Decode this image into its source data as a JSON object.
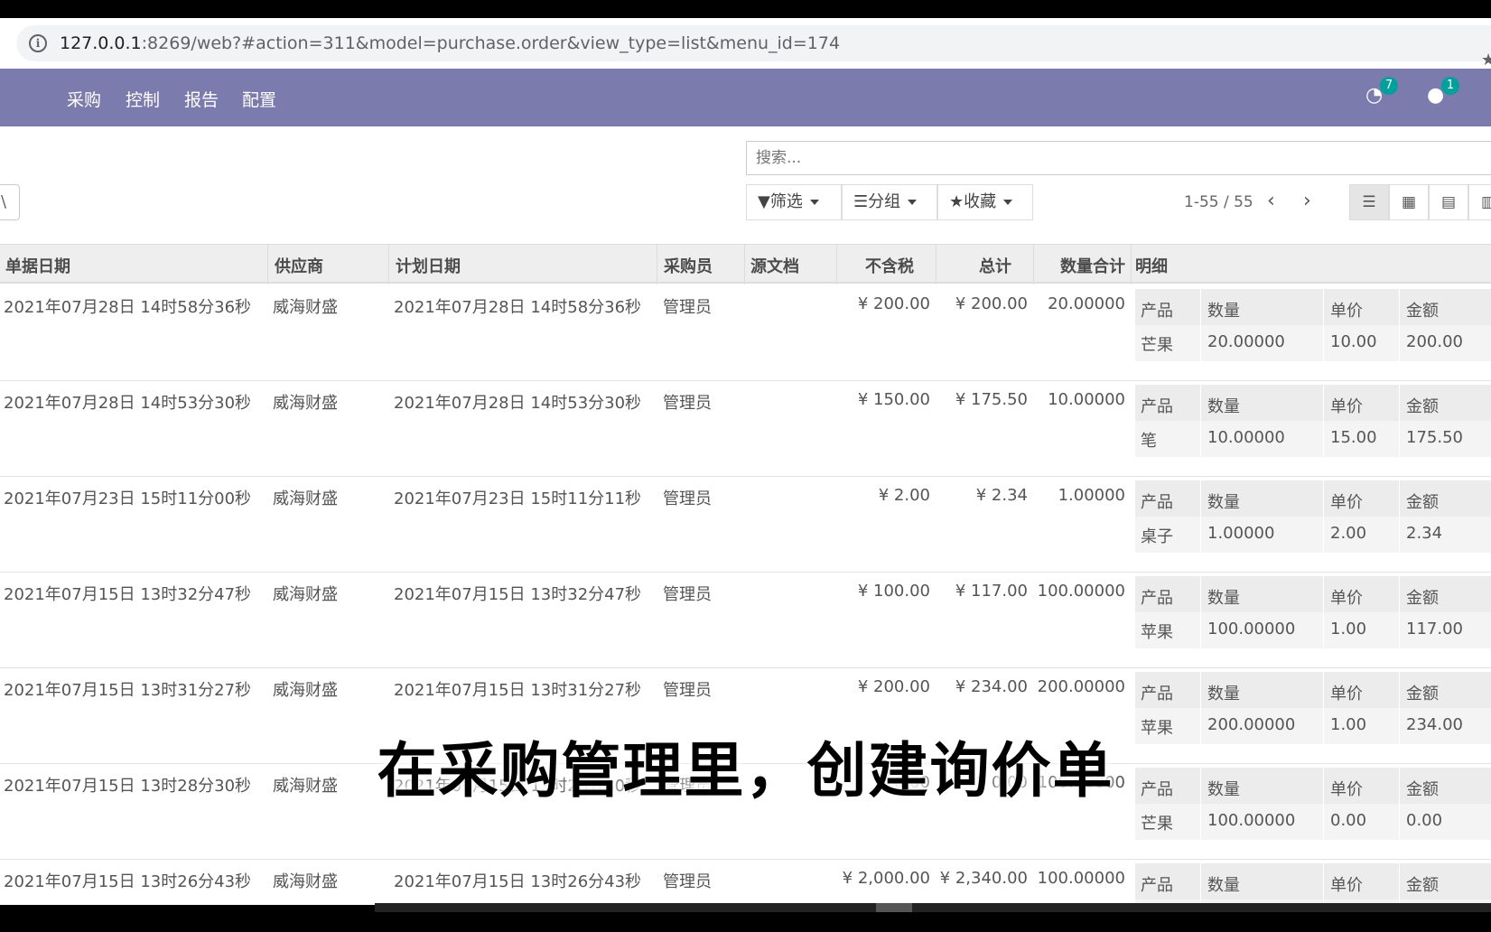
{
  "browser": {
    "url_host": "127.0.0.1",
    "url_path": ":8269/web?#action=311&model=purchase.order&view_type=list&menu_id=174"
  },
  "navbar": {
    "items": [
      "采购",
      "控制",
      "报告",
      "配置"
    ],
    "activity_count": "7",
    "message_count": "1"
  },
  "control_panel": {
    "search_placeholder": "搜索...",
    "create_stub": "\\",
    "filter_label": "筛选",
    "group_label": "分组",
    "favorites_label": "收藏",
    "pager": "1-55 / 55"
  },
  "table": {
    "headers": {
      "date": "单据日期",
      "vendor": "供应商",
      "planned": "计划日期",
      "buyer": "采购员",
      "source": "源文档",
      "untaxed": "不含税",
      "total": "总计",
      "qty": "数量合计",
      "detail": "明细"
    },
    "detail_headers": [
      "产品",
      "数量",
      "单价",
      "金额"
    ],
    "rows": [
      {
        "date": "2021年07月28日 14时58分36秒",
        "vendor": "威海财盛",
        "planned": "2021年07月28日 14时58分36秒",
        "buyer": "管理员",
        "source": "",
        "untaxed": "¥ 200.00",
        "total": "¥ 200.00",
        "qty": "20.00000",
        "line": {
          "product": "芒果",
          "qty": "20.00000",
          "price": "10.00",
          "amount": "200.00"
        }
      },
      {
        "date": "2021年07月28日 14时53分30秒",
        "vendor": "威海财盛",
        "planned": "2021年07月28日 14时53分30秒",
        "buyer": "管理员",
        "source": "",
        "untaxed": "¥ 150.00",
        "total": "¥ 175.50",
        "qty": "10.00000",
        "line": {
          "product": "笔",
          "qty": "10.00000",
          "price": "15.00",
          "amount": "175.50"
        }
      },
      {
        "date": "2021年07月23日 15时11分00秒",
        "vendor": "威海财盛",
        "planned": "2021年07月23日 15时11分11秒",
        "buyer": "管理员",
        "source": "",
        "untaxed": "¥ 2.00",
        "total": "¥ 2.34",
        "qty": "1.00000",
        "line": {
          "product": "桌子",
          "qty": "1.00000",
          "price": "2.00",
          "amount": "2.34"
        }
      },
      {
        "date": "2021年07月15日 13时32分47秒",
        "vendor": "威海财盛",
        "planned": "2021年07月15日 13时32分47秒",
        "buyer": "管理员",
        "source": "",
        "untaxed": "¥ 100.00",
        "total": "¥ 117.00",
        "qty": "100.00000",
        "line": {
          "product": "苹果",
          "qty": "100.00000",
          "price": "1.00",
          "amount": "117.00"
        }
      },
      {
        "date": "2021年07月15日 13时31分27秒",
        "vendor": "威海财盛",
        "planned": "2021年07月15日 13时31分27秒",
        "buyer": "管理员",
        "source": "",
        "untaxed": "¥ 200.00",
        "total": "¥ 234.00",
        "qty": "200.00000",
        "line": {
          "product": "苹果",
          "qty": "200.00000",
          "price": "1.00",
          "amount": "234.00"
        }
      },
      {
        "date": "2021年07月15日 13时28分30秒",
        "vendor": "威海财盛",
        "planned": "2021年07月15日 13时28分30秒",
        "buyer": "管理员",
        "source": "",
        "untaxed": "¥ 0.00",
        "total": "¥ 0.00",
        "qty": "100.00000",
        "line": {
          "product": "芒果",
          "qty": "100.00000",
          "price": "0.00",
          "amount": "0.00"
        }
      },
      {
        "date": "2021年07月15日 13时26分43秒",
        "vendor": "威海财盛",
        "planned": "2021年07月15日 13时26分43秒",
        "buyer": "管理员",
        "source": "",
        "untaxed": "¥ 2,000.00",
        "total": "¥ 2,340.00",
        "qty": "100.00000",
        "line": null
      }
    ]
  },
  "subtitle": "在采购管理里，创建询价单"
}
